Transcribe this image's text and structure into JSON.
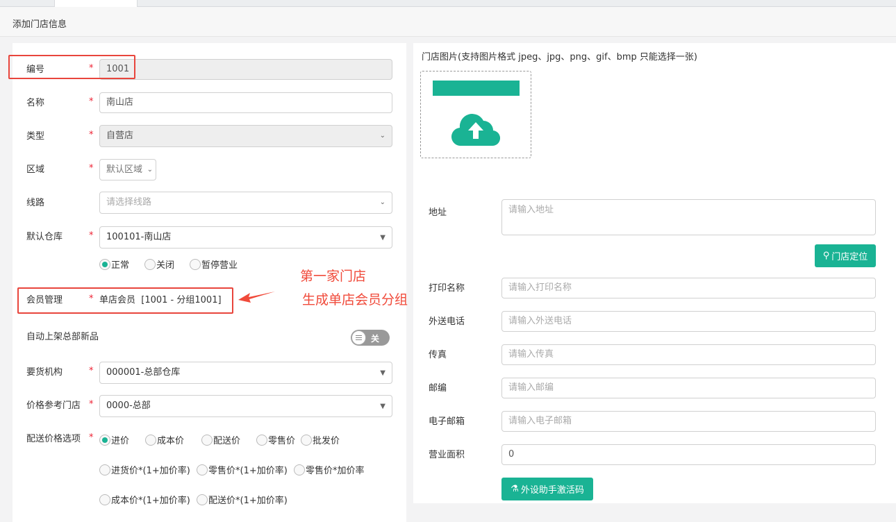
{
  "header": {
    "title": "添加门店信息"
  },
  "form": {
    "code": {
      "label": "编号",
      "value": "1001"
    },
    "name": {
      "label": "名称",
      "value": "南山店"
    },
    "type": {
      "label": "类型",
      "value": "自营店"
    },
    "region": {
      "label": "区域",
      "value": "默认区域"
    },
    "route": {
      "label": "线路",
      "placeholder": "请选择线路"
    },
    "warehouse": {
      "label": "默认仓库",
      "value": "100101-南山店"
    },
    "status": {
      "options": [
        "正常",
        "关闭",
        "暂停营业"
      ],
      "selected": "正常"
    },
    "member": {
      "label": "会员管理",
      "value": "单店会员  [1001 - 分组1001]"
    },
    "auto_shelf": {
      "label": "自动上架总部新品",
      "toggle": "关",
      "on": false
    },
    "supplier": {
      "label": "要货机构",
      "value": "000001-总部仓库"
    },
    "price_ref": {
      "label": "价格参考门店",
      "value": "0000-总部"
    },
    "delivery_price": {
      "label": "配送价格选项",
      "options": [
        "进价",
        "成本价",
        "配送价",
        "零售价",
        "批发价",
        "进货价*(1+加价率)",
        "零售价*(1+加价率)",
        "零售价*加价率",
        "成本价*(1+加价率)",
        "配送价*(1+加价率)"
      ],
      "selected": "进价"
    }
  },
  "annotation": {
    "line1": "第一家门店",
    "line2": "生成单店会员分组",
    "color": "#f04a3a"
  },
  "right": {
    "image_label": "门店图片(支持图片格式 jpeg、jpg、png、gif、bmp 只能选择一张)",
    "address": {
      "label": "地址",
      "placeholder": "请输入地址"
    },
    "locate_button": "门店定位",
    "print_name": {
      "label": "打印名称",
      "placeholder": "请输入打印名称"
    },
    "delivery_phone": {
      "label": "外送电话",
      "placeholder": "请输入外送电话"
    },
    "fax": {
      "label": "传真",
      "placeholder": "请输入传真"
    },
    "postcode": {
      "label": "邮编",
      "placeholder": "请输入邮编"
    },
    "email": {
      "label": "电子邮箱",
      "placeholder": "请输入电子邮箱"
    },
    "area": {
      "label": "营业面积",
      "value": "0"
    },
    "activation_button": "外设助手激活码"
  },
  "colors": {
    "accent": "#1ab394",
    "annotation": "#f04a3a"
  }
}
